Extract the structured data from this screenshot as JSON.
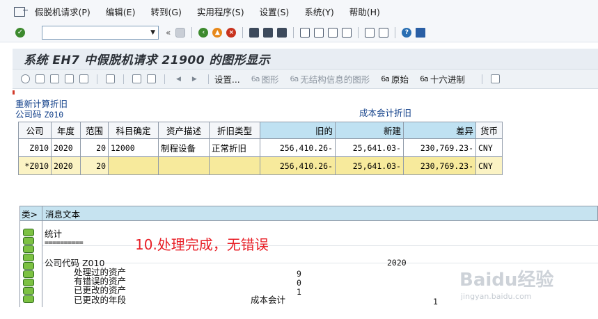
{
  "menubar": {
    "items": [
      "假脱机请求(P)",
      "编辑(E)",
      "转到(G)",
      "实用程序(S)",
      "设置(S)",
      "系统(Y)",
      "帮助(H)"
    ]
  },
  "toolbar": {
    "command_field_value": "",
    "back_glyph": "«"
  },
  "title": "系统 EH7 中假脱机请求 21900 的图形显示",
  "app_toolbar": {
    "settings": "设置...",
    "graphic": "图形",
    "unstructured": "无结构信息的图形",
    "raw": "原始",
    "hex": "十六进制"
  },
  "labels": {
    "recalc": "重新计算折旧",
    "company_code_label": "公司码",
    "company_code_value": "Z010",
    "cost_accounting": "成本会计折旧"
  },
  "table": {
    "headers": [
      "公司",
      "年度",
      "范围",
      "科目确定",
      "资产描述",
      "折旧类型",
      "旧的",
      "新建",
      "差异",
      "货币"
    ],
    "rows": [
      [
        "Z010",
        "2020",
        "20",
        "12000",
        "制程设备",
        "正常折旧",
        "256,410.26-",
        "25,641.03-",
        "230,769.23-",
        "CNY"
      ],
      [
        "*Z010",
        "2020",
        "20",
        "",
        "",
        "",
        "256,410.26-",
        "25,641.03-",
        "230,769.23-",
        "CNY"
      ]
    ]
  },
  "messages": {
    "col_type": "类>",
    "col_text": "消息文本",
    "stat_title": "统计",
    "stat_rule": "==========",
    "company_code_line": "公司代码 Z010",
    "year": "2020",
    "processed_label": "处理过的资产",
    "processed_value": "9",
    "error_label": "有错误的资产",
    "error_value": "0",
    "changed_label": "已更改的资产",
    "changed_value": "1",
    "changed_period_label": "已更改的年段",
    "changed_period_area": "成本会计",
    "changed_period_value": "1"
  },
  "annotation": "10.处理完成，无错误",
  "watermark": {
    "logo": "Baidu经验",
    "url": "jingyan.baidu.com"
  }
}
